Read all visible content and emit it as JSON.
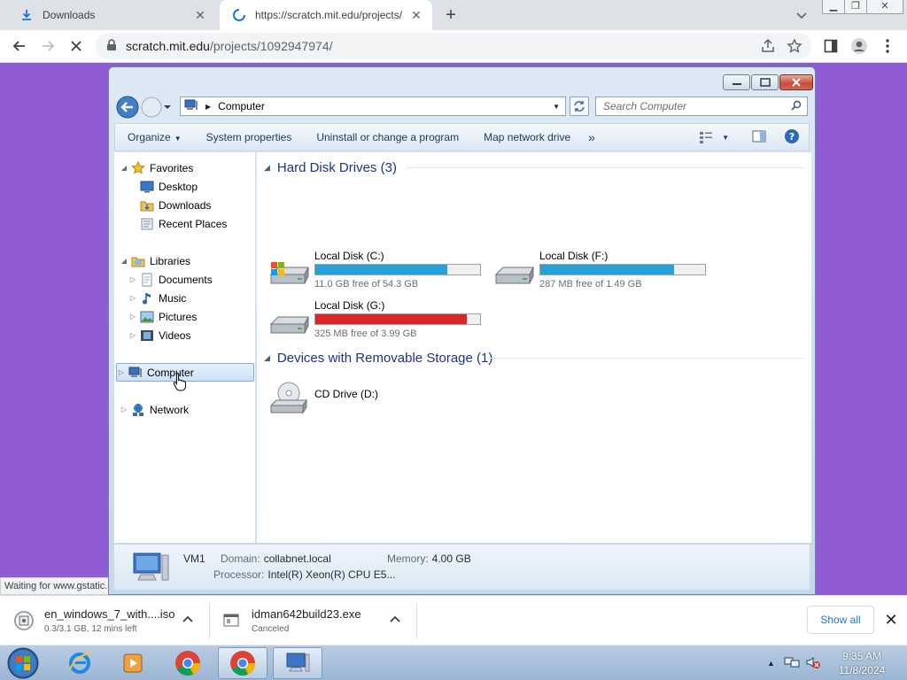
{
  "browser": {
    "tabs": [
      {
        "title": "Downloads",
        "icon": "download-icon",
        "active": false
      },
      {
        "title": "https://scratch.mit.edu/projects/",
        "icon": "loading-spinner-icon",
        "active": true
      }
    ],
    "url": {
      "host": "scratch.mit.edu",
      "path": "/projects/1092947974/"
    },
    "status_text": "Waiting for www.gstatic.com..."
  },
  "downloads": {
    "items": [
      {
        "name": "en_windows_7_with....iso",
        "status": "0.3/3.1 GB, 12 mins left"
      },
      {
        "name": "idman642build23.exe",
        "status": "Canceled"
      }
    ],
    "show_all_label": "Show all"
  },
  "explorer": {
    "address": {
      "crumb": "Computer"
    },
    "search_placeholder": "Search Computer",
    "commands": {
      "organize": "Organize",
      "system_properties": "System properties",
      "uninstall": "Uninstall or change a program",
      "map_drive": "Map network drive",
      "more": "»"
    },
    "nav": {
      "favorites": "Favorites",
      "desktop": "Desktop",
      "downloads": "Downloads",
      "recent": "Recent Places",
      "libraries": "Libraries",
      "documents": "Documents",
      "music": "Music",
      "pictures": "Pictures",
      "videos": "Videos",
      "computer": "Computer",
      "network": "Network"
    },
    "groups": {
      "hdd": "Hard Disk Drives (3)",
      "removable": "Devices with Removable Storage (1)"
    },
    "drives": [
      {
        "label": "Local Disk (C:)",
        "free": "11.0 GB free of 54.3 GB",
        "used_fraction": 0.8,
        "color": "#26a0da"
      },
      {
        "label": "Local Disk (F:)",
        "free": "287 MB free of 1.49 GB",
        "used_fraction": 0.81,
        "color": "#26a0da"
      },
      {
        "label": "Local Disk (G:)",
        "free": "325 MB free of 3.99 GB",
        "used_fraction": 0.92,
        "color": "#da2626"
      }
    ],
    "removable": [
      {
        "label": "CD Drive (D:)"
      }
    ],
    "details": {
      "name": "VM1",
      "domain_label": "Domain:",
      "domain": "collabnet.local",
      "memory_label": "Memory:",
      "memory": "4.00 GB",
      "processor_label": "Processor:",
      "processor": "Intel(R) Xeon(R) CPU E5..."
    }
  },
  "taskbar": {
    "time": "9:35 AM",
    "date": "11/8/2024"
  }
}
